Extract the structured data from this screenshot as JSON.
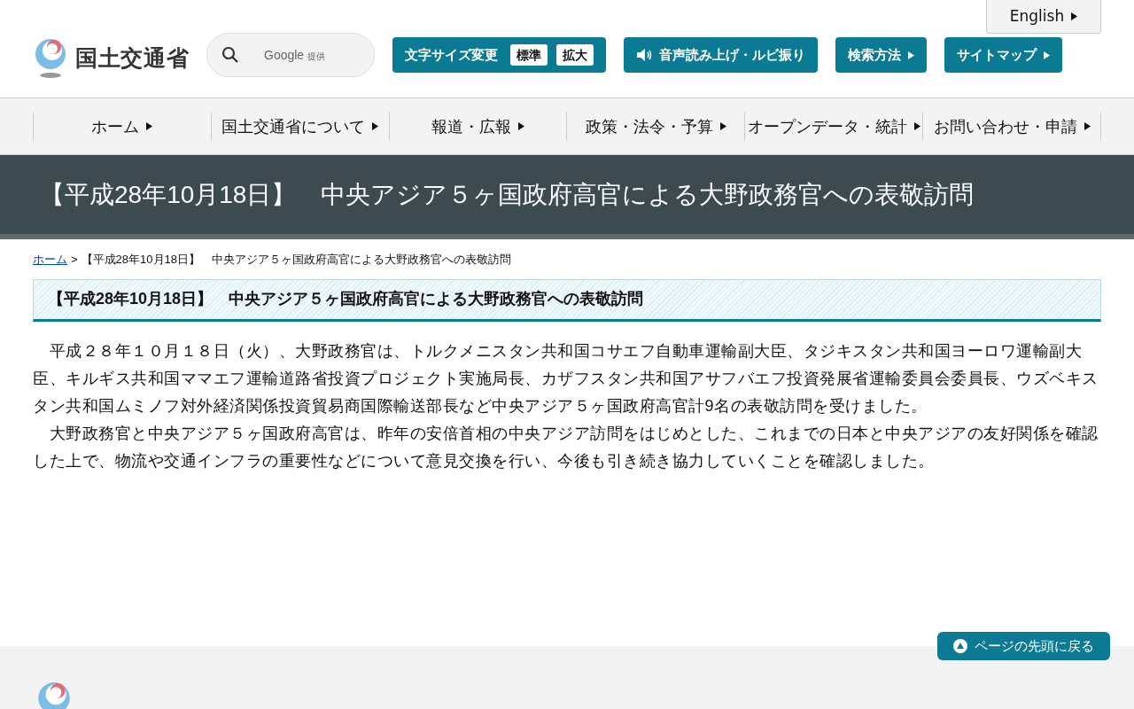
{
  "header": {
    "logo_text": "国土交通省",
    "search": {
      "placeholder": "Google",
      "provider": "提供"
    },
    "english_link": "English",
    "font_size": {
      "label": "文字サイズ変更",
      "options": [
        {
          "label": "標準"
        },
        {
          "label": "拡大"
        }
      ]
    },
    "buttons": [
      {
        "kind": "speaker",
        "label": "音声読み上げ・ルビ振り"
      },
      {
        "kind": "arrow",
        "label": "検索方法"
      },
      {
        "kind": "arrow",
        "label": "サイトマップ"
      }
    ]
  },
  "nav": [
    {
      "label": "ホーム"
    },
    {
      "label": "国土交通省について"
    },
    {
      "label": "報道・広報"
    },
    {
      "label": "政策・法令・予算"
    },
    {
      "label": "オープンデータ・統計"
    },
    {
      "label": "お問い合わせ・申請"
    }
  ],
  "page_title": "【平成28年10月18日】　中央アジア５ヶ国政府高官による大野政務官への表敬訪問",
  "breadcrumb": {
    "home": "ホーム",
    "separator": ">",
    "current": "【平成28年10月18日】　中央アジア５ヶ国政府高官による大野政務官への表敬訪問"
  },
  "heading": "【平成28年10月18日】　中央アジア５ヶ国政府高官による大野政務官への表敬訪問",
  "paragraphs": [
    "　平成２８年１０月１８日（火）、大野政務官は、トルクメニスタン共和国コサエフ自動車運輸副大臣、タジキスタン共和国ヨーロワ運輸副大臣、キルギス共和国ママエフ運輸道路省投資プロジェクト実施局長、カザフスタン共和国アサフバエフ投資発展省運輸委員会委員長、ウズベキスタン共和国ムミノフ対外経済関係投資貿易商国際輸送部長など中央アジア５ヶ国政府高官計9名の表敬訪問を受けました。",
    "　大野政務官と中央アジア５ヶ国政府高官は、昨年の安倍首相の中央アジア訪問をはじめとした、これまでの日本と中央アジアの友好関係を確認した上で、物流や交通インフラの重要性などについて意見交換を行い、今後も引き続き協力していくことを確認しました。"
  ],
  "back_to_top": "ページの先頭に戻る"
}
